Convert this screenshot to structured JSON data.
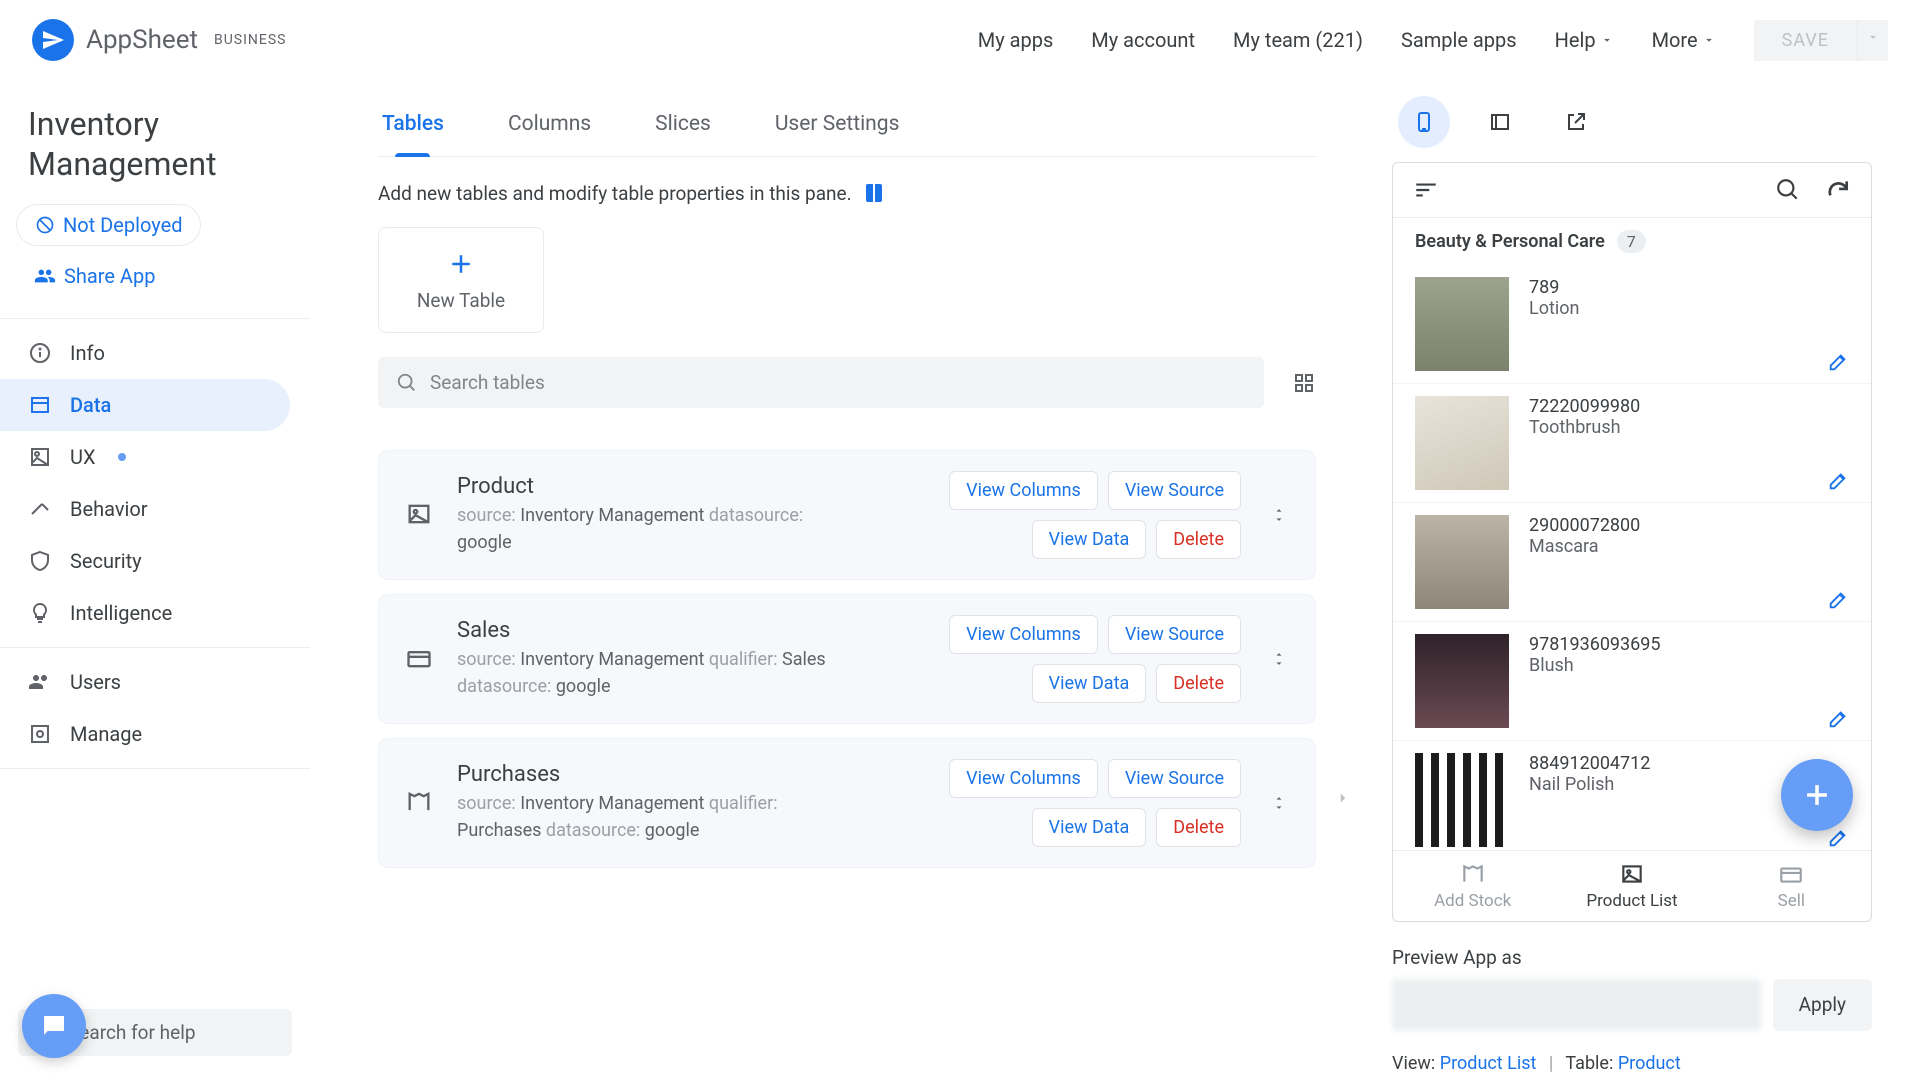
{
  "brand": {
    "name": "AppSheet",
    "badge": "BUSINESS"
  },
  "header_nav": {
    "my_apps": "My apps",
    "my_account": "My account",
    "my_team": "My team (221)",
    "sample_apps": "Sample apps",
    "help": "Help",
    "more": "More",
    "save": "SAVE"
  },
  "sidebar": {
    "app_title": "Inventory Management",
    "deploy_label": "Not Deployed",
    "share_label": "Share App",
    "items": [
      {
        "label": "Info"
      },
      {
        "label": "Data"
      },
      {
        "label": "UX"
      },
      {
        "label": "Behavior"
      },
      {
        "label": "Security"
      },
      {
        "label": "Intelligence"
      }
    ],
    "secondary": [
      {
        "label": "Users"
      },
      {
        "label": "Manage"
      }
    ],
    "search_help": "Search for help"
  },
  "content": {
    "tabs": [
      "Tables",
      "Columns",
      "Slices",
      "User Settings"
    ],
    "description": "Add new tables and modify table properties in this pane.",
    "new_table": "New Table",
    "search_placeholder": "Search tables",
    "buttons": {
      "view_columns": "View Columns",
      "view_source": "View Source",
      "view_data": "View Data",
      "delete": "Delete"
    },
    "tables": [
      {
        "name": "Product",
        "meta": "source: |Inventory Management|   datasource: |google|"
      },
      {
        "name": "Sales",
        "meta": "source: |Inventory Management|   qualifier: |Sales|   datasource: |google|"
      },
      {
        "name": "Purchases",
        "meta": "source: |Inventory Management|   qualifier: |Purchases|   datasource: |google|"
      }
    ]
  },
  "preview": {
    "category": "Beauty & Personal Care",
    "category_count": "7",
    "items": [
      {
        "code": "789",
        "name": "Lotion",
        "thumb": "lotion"
      },
      {
        "code": "72220099980",
        "name": "Toothbrush",
        "thumb": "brush"
      },
      {
        "code": "29000072800",
        "name": "Mascara",
        "thumb": "mascara"
      },
      {
        "code": "9781936093695",
        "name": "Blush",
        "thumb": "blush"
      },
      {
        "code": "884912004712",
        "name": "Nail Polish",
        "thumb": "nail"
      }
    ],
    "bottom_tabs": [
      "Add Stock",
      "Product List",
      "Sell"
    ],
    "preview_as": "Preview App as",
    "apply": "Apply",
    "view_label": "View:",
    "view_value": "Product List",
    "table_label": "Table:",
    "table_value": "Product"
  }
}
